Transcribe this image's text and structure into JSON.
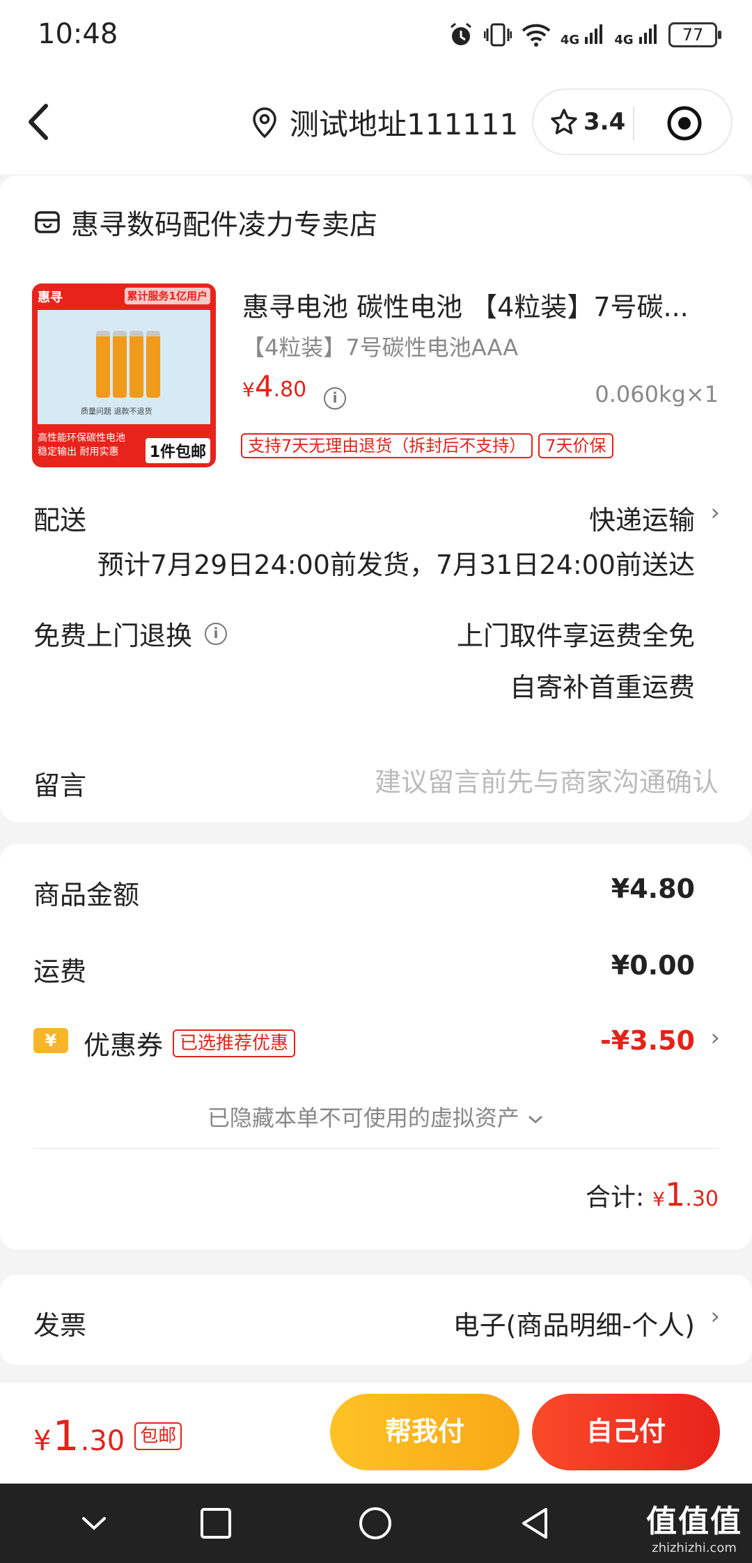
{
  "status_bar": {
    "time": "10:48",
    "battery": "77",
    "signal_label_1": "4G",
    "signal_label_2": "4G"
  },
  "header": {
    "address": "测试地址111111",
    "rating": "3.4"
  },
  "store": {
    "name": "惠寻数码配件凌力专卖店"
  },
  "product": {
    "title": "惠寻电池 碳性电池 【4粒装】7号碳...",
    "spec": "【4粒装】7号碳性电池AAA",
    "price_currency": "¥",
    "price_int": "4",
    "price_dec": ".80",
    "weight_qty": "0.060kg×1",
    "tags": [
      "支持7天无理由退货（拆封后不支持）",
      "7天价保"
    ],
    "image": {
      "brand": "惠寻",
      "badge_top": "累计服务1亿用户",
      "note": "质量问题 退款不退货",
      "line1": "高性能环保碳性电池",
      "line2": "稳定输出 耐用实惠",
      "badge": "1件包邮"
    }
  },
  "delivery": {
    "label": "配送",
    "method": "快递运输",
    "estimate": "预计7月29日24:00前发货，7月31日24:00前送达"
  },
  "return": {
    "label": "免费上门退换",
    "line1": "上门取件享运费全免",
    "line2": "自寄补首重运费"
  },
  "message": {
    "label": "留言",
    "placeholder": "建议留言前先与商家沟通确认"
  },
  "summary": {
    "goods_label": "商品金额",
    "goods_value": "¥4.80",
    "shipping_label": "运费",
    "shipping_value": "¥0.00",
    "coupon_icon_text": "¥",
    "coupon_label": "优惠券",
    "coupon_tag": "已选推荐优惠",
    "coupon_value": "-¥3.50",
    "hidden_assets": "已隐藏本单不可使用的虚拟资产",
    "total_label": "合计:",
    "total_currency": "¥",
    "total_int": "1",
    "total_dec": ".30"
  },
  "invoice": {
    "label": "发票",
    "value": "电子(商品明细-个人)"
  },
  "bottom_bar": {
    "currency": "¥",
    "price_int": "1",
    "price_dec": ".30",
    "ship_tag": "包邮",
    "help_pay": "帮我付",
    "self_pay": "自己付"
  },
  "watermark": {
    "big": "值值值",
    "small": "zhizhizhi.com"
  },
  "colors": {
    "accent_red": "#e2231a",
    "button_yellow": "#fdc226",
    "button_red": "#e8231b",
    "coupon_yellow": "#f7b52a"
  }
}
